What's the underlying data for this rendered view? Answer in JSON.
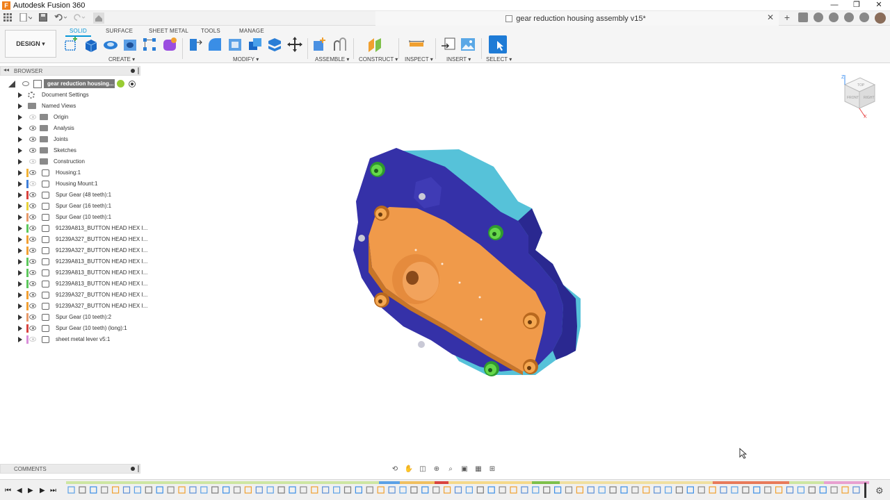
{
  "window": {
    "app_title": "Autodesk Fusion 360",
    "logo_letter": "F",
    "minimize": "—",
    "restore": "❐",
    "close": "✕"
  },
  "document": {
    "tab_title": "gear reduction housing assembly v15*",
    "close": "✕"
  },
  "ribbon": {
    "workspace": "DESIGN ▾",
    "tabs": [
      "SOLID",
      "SURFACE",
      "SHEET METAL",
      "TOOLS",
      "MANAGE"
    ],
    "groups": [
      "CREATE ▾",
      "MODIFY ▾",
      "ASSEMBLE ▾",
      "CONSTRUCT ▾",
      "INSPECT ▾",
      "INSERT ▾",
      "SELECT ▾"
    ],
    "accent": "#0696d7"
  },
  "browser": {
    "title": "BROWSER",
    "collapse": "◂◂",
    "root": "gear reduction housing...",
    "items": [
      {
        "label": "Document Settings",
        "type": "gear",
        "eye": "none",
        "color": ""
      },
      {
        "label": "Named Views",
        "type": "folder",
        "eye": "none",
        "color": ""
      },
      {
        "label": "Origin",
        "type": "folder",
        "eye": "off",
        "color": ""
      },
      {
        "label": "Analysis",
        "type": "folder",
        "eye": "on",
        "color": ""
      },
      {
        "label": "Joints",
        "type": "folder",
        "eye": "on",
        "color": ""
      },
      {
        "label": "Sketches",
        "type": "folder",
        "eye": "on",
        "color": ""
      },
      {
        "label": "Construction",
        "type": "folder",
        "eye": "off",
        "color": ""
      },
      {
        "label": "Housing:1",
        "type": "comp",
        "eye": "on",
        "color": "#f2b233"
      },
      {
        "label": "Housing Mount:1",
        "type": "comp",
        "eye": "off",
        "color": "#3f7fd9"
      },
      {
        "label": "Spur Gear (48 teeth):1",
        "type": "comp",
        "eye": "on",
        "color": "#d9433f"
      },
      {
        "label": "Spur Gear (16 teeth):1",
        "type": "comp",
        "eye": "on",
        "color": "#e8d23a"
      },
      {
        "label": "Spur Gear (10 teeth):1",
        "type": "comp",
        "eye": "on",
        "color": "#e89a6a"
      },
      {
        "label": "91239A813_BUTTON HEAD HEX I...",
        "type": "comp",
        "eye": "on",
        "color": "#5cc85c"
      },
      {
        "label": "91239A327_BUTTON HEAD HEX I...",
        "type": "comp",
        "eye": "on",
        "color": "#f2a033"
      },
      {
        "label": "91239A327_BUTTON HEAD HEX I...",
        "type": "comp",
        "eye": "on",
        "color": "#f2a033"
      },
      {
        "label": "91239A813_BUTTON HEAD HEX I...",
        "type": "comp",
        "eye": "on",
        "color": "#5cc85c"
      },
      {
        "label": "91239A813_BUTTON HEAD HEX I...",
        "type": "comp",
        "eye": "on",
        "color": "#5cc85c"
      },
      {
        "label": "91239A813_BUTTON HEAD HEX I...",
        "type": "comp",
        "eye": "on",
        "color": "#5cc85c"
      },
      {
        "label": "91239A327_BUTTON HEAD HEX I...",
        "type": "comp",
        "eye": "on",
        "color": "#f2a033"
      },
      {
        "label": "91239A327_BUTTON HEAD HEX I...",
        "type": "comp",
        "eye": "on",
        "color": "#f2a033"
      },
      {
        "label": "Spur Gear (10 teeth):2",
        "type": "comp",
        "eye": "on",
        "color": "#e89a6a"
      },
      {
        "label": "Spur Gear (10 teeth) (long):1",
        "type": "comp",
        "eye": "on",
        "color": "#d9433f"
      },
      {
        "label": "sheet metal lever v5:1",
        "type": "comp",
        "eye": "off",
        "color": "#d98fd9"
      }
    ]
  },
  "viewcube": {
    "top": "TOP",
    "front": "FRONT",
    "right": "RIGHT",
    "z_axis": "Z",
    "x_axis": "X"
  },
  "comments": {
    "title": "COMMENTS"
  },
  "navbar": {
    "icons": [
      "orbit-icon",
      "pan-icon",
      "look-at-icon",
      "zoom-icon",
      "fit-icon",
      "display-settings-icon",
      "grid-icon",
      "viewports-icon"
    ]
  },
  "timeline": {
    "first": "⏮",
    "prev": "◀",
    "play": "▶",
    "next": "▶",
    "last": "⏭",
    "settings": "⚙"
  }
}
